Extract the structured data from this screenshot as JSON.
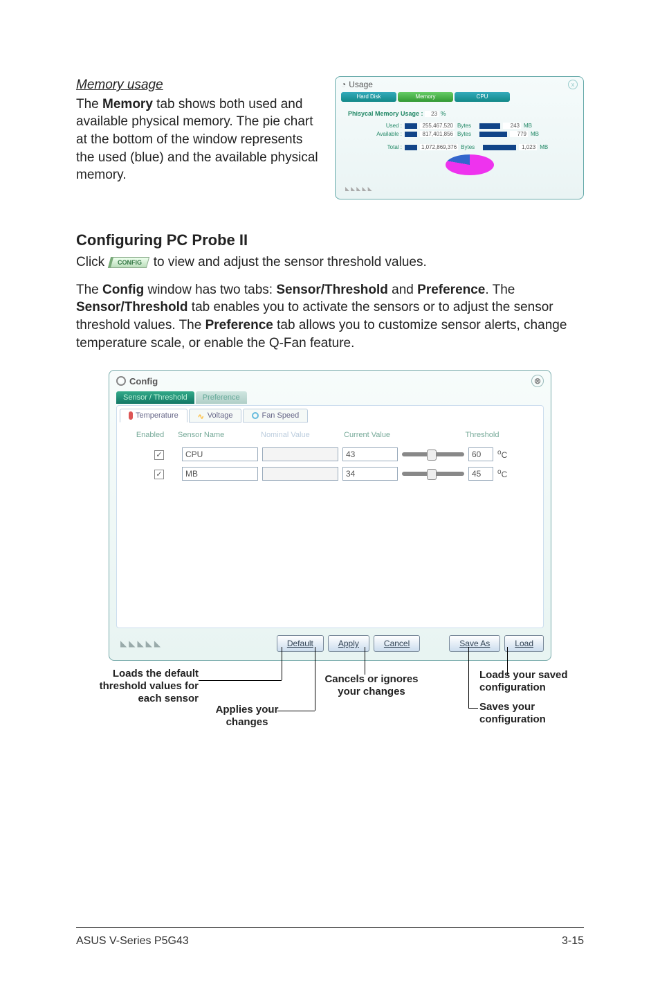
{
  "memory_section": {
    "heading": "Memory usage",
    "paragraph_pre": "The ",
    "paragraph_bold": "Memory",
    "paragraph_post": " tab shows both used and available physical memory. The pie chart at the bottom of the window represents the used (blue) and the available physical memory."
  },
  "usage_window": {
    "title": "Usage",
    "tabs": {
      "hd": "Hard Disk",
      "mem": "Memory",
      "cpu": "CPU"
    },
    "body_label": "Phisycal Memory Usage :",
    "body_pct": "23",
    "pct_unit": "%",
    "rows": [
      {
        "label": "Used :",
        "bytes": "255,467,520",
        "bunit": "Bytes",
        "mb": "243",
        "munit": "MB",
        "bar": 30
      },
      {
        "label": "Available :",
        "bytes": "817,401,856",
        "bunit": "Bytes",
        "mb": "779",
        "munit": "MB",
        "bar": 70
      },
      {
        "label": "Total :",
        "bytes": "1,072,869,376",
        "bunit": "Bytes",
        "mb": "1,023",
        "munit": "MB",
        "bar": 90
      }
    ]
  },
  "config_section": {
    "heading": "Configuring PC Probe II",
    "click_pre": "Click ",
    "config_btn": "CONFIG",
    "click_post": " to view and adjust the sensor threshold values.",
    "para2_parts": {
      "a": "The ",
      "b": "Config",
      "c": " window has two tabs: ",
      "d": "Sensor/Threshold",
      "e": " and ",
      "f": "Preference",
      "g": ". The ",
      "h": "Sensor/Threshold",
      "i": " tab enables you to activate the sensors or to adjust the sensor threshold values. The ",
      "j": "Preference",
      "k": " tab allows you to customize sensor alerts, change temperature scale, or enable the Q-Fan feature."
    }
  },
  "config_window": {
    "title": "Config",
    "top_tabs": {
      "sensor": "Sensor / Threshold",
      "pref": "Preference"
    },
    "sub_tabs": {
      "temp": "Temperature",
      "volt": "Voltage",
      "fan": "Fan Speed"
    },
    "columns": {
      "enabled": "Enabled",
      "name": "Sensor Name",
      "nominal": "Nominal Value",
      "current": "Current Value",
      "threshold": "Threshold"
    },
    "rows": [
      {
        "name": "CPU",
        "current": "43",
        "threshold": "60",
        "unit": "C"
      },
      {
        "name": "MB",
        "current": "34",
        "threshold": "45",
        "unit": "C"
      }
    ],
    "buttons": {
      "default": "Default",
      "apply": "Apply",
      "cancel": "Cancel",
      "saveas": "Save As",
      "load": "Load"
    }
  },
  "callouts": {
    "default": "Loads the default threshold values for each sensor",
    "apply": "Applies your changes",
    "cancel": "Cancels or ignores your changes",
    "load": "Loads your saved configuration",
    "saveas": "Saves your configuration"
  },
  "footer": {
    "left": "ASUS V-Series P5G43",
    "right": "3-15"
  }
}
